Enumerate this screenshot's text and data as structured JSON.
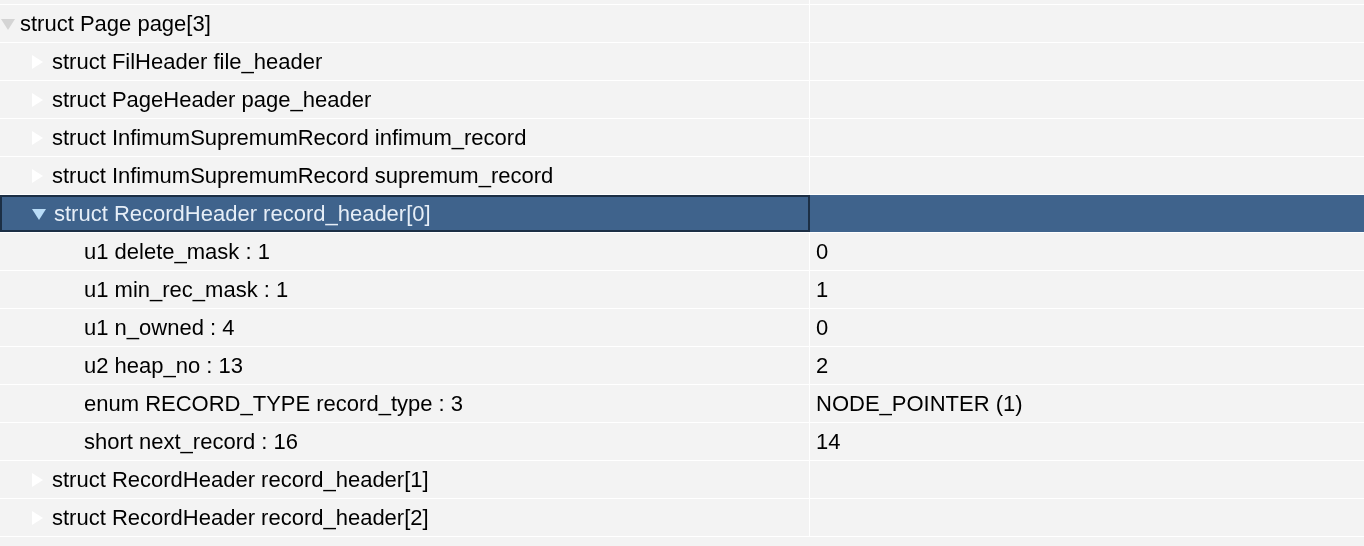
{
  "tree": [
    {
      "label": "struct Page page[3]",
      "expanded": true,
      "selected": false,
      "children": [
        {
          "label": "struct FilHeader file_header",
          "expanded": false,
          "selected": false
        },
        {
          "label": "struct PageHeader page_header",
          "expanded": false,
          "selected": false
        },
        {
          "label": "struct InfimumSupremumRecord infimum_record",
          "expanded": false,
          "selected": false
        },
        {
          "label": "struct InfimumSupremumRecord supremum_record",
          "expanded": false,
          "selected": false
        },
        {
          "label": "struct RecordHeader record_header[0]",
          "expanded": true,
          "selected": true,
          "children": [
            {
              "label": "u1 delete_mask : 1",
              "value": "0",
              "selected": false
            },
            {
              "label": "u1 min_rec_mask : 1",
              "value": "1",
              "selected": false
            },
            {
              "label": "u1 n_owned : 4",
              "value": "0",
              "selected": false
            },
            {
              "label": "u2 heap_no : 13",
              "value": "2",
              "selected": false
            },
            {
              "label": "enum RECORD_TYPE record_type : 3",
              "value": "NODE_POINTER (1)",
              "selected": false
            },
            {
              "label": "short next_record : 16",
              "value": "14",
              "selected": false
            }
          ]
        },
        {
          "label": "struct RecordHeader record_header[1]",
          "expanded": false,
          "selected": false
        },
        {
          "label": "struct RecordHeader record_header[2]",
          "expanded": false,
          "selected": false
        }
      ]
    }
  ]
}
